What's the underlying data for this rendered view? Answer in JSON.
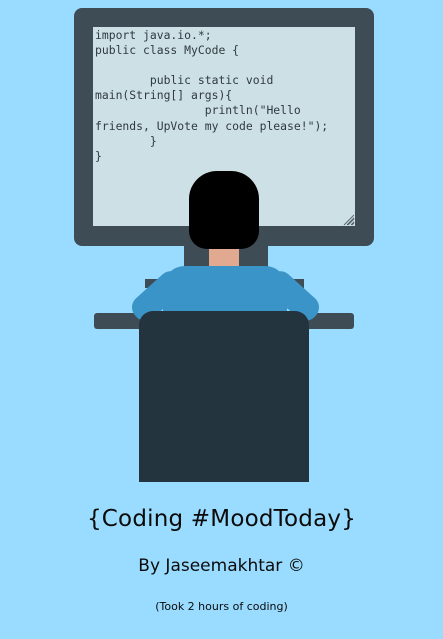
{
  "editor": {
    "code": "import java.io.*;\npublic class MyCode {\n\n        public static void\nmain(String[] args){\n                println(\"Hello\nfriends, UpVote my code please!\");\n        }\n}"
  },
  "footer": {
    "title": "{Coding #MoodToday}",
    "author": "By Jaseemakhtar ©",
    "note": "(Took 2 hours of coding)"
  },
  "colors": {
    "background": "#9adcff",
    "monitor": "#3e4d55",
    "screen": "#cde0e6",
    "shirt": "#3a94c7",
    "chair": "#24343e",
    "skin": "#e1a98f",
    "hair": "#000000"
  },
  "icons": {
    "resize_handle": "resize-grip-icon"
  }
}
